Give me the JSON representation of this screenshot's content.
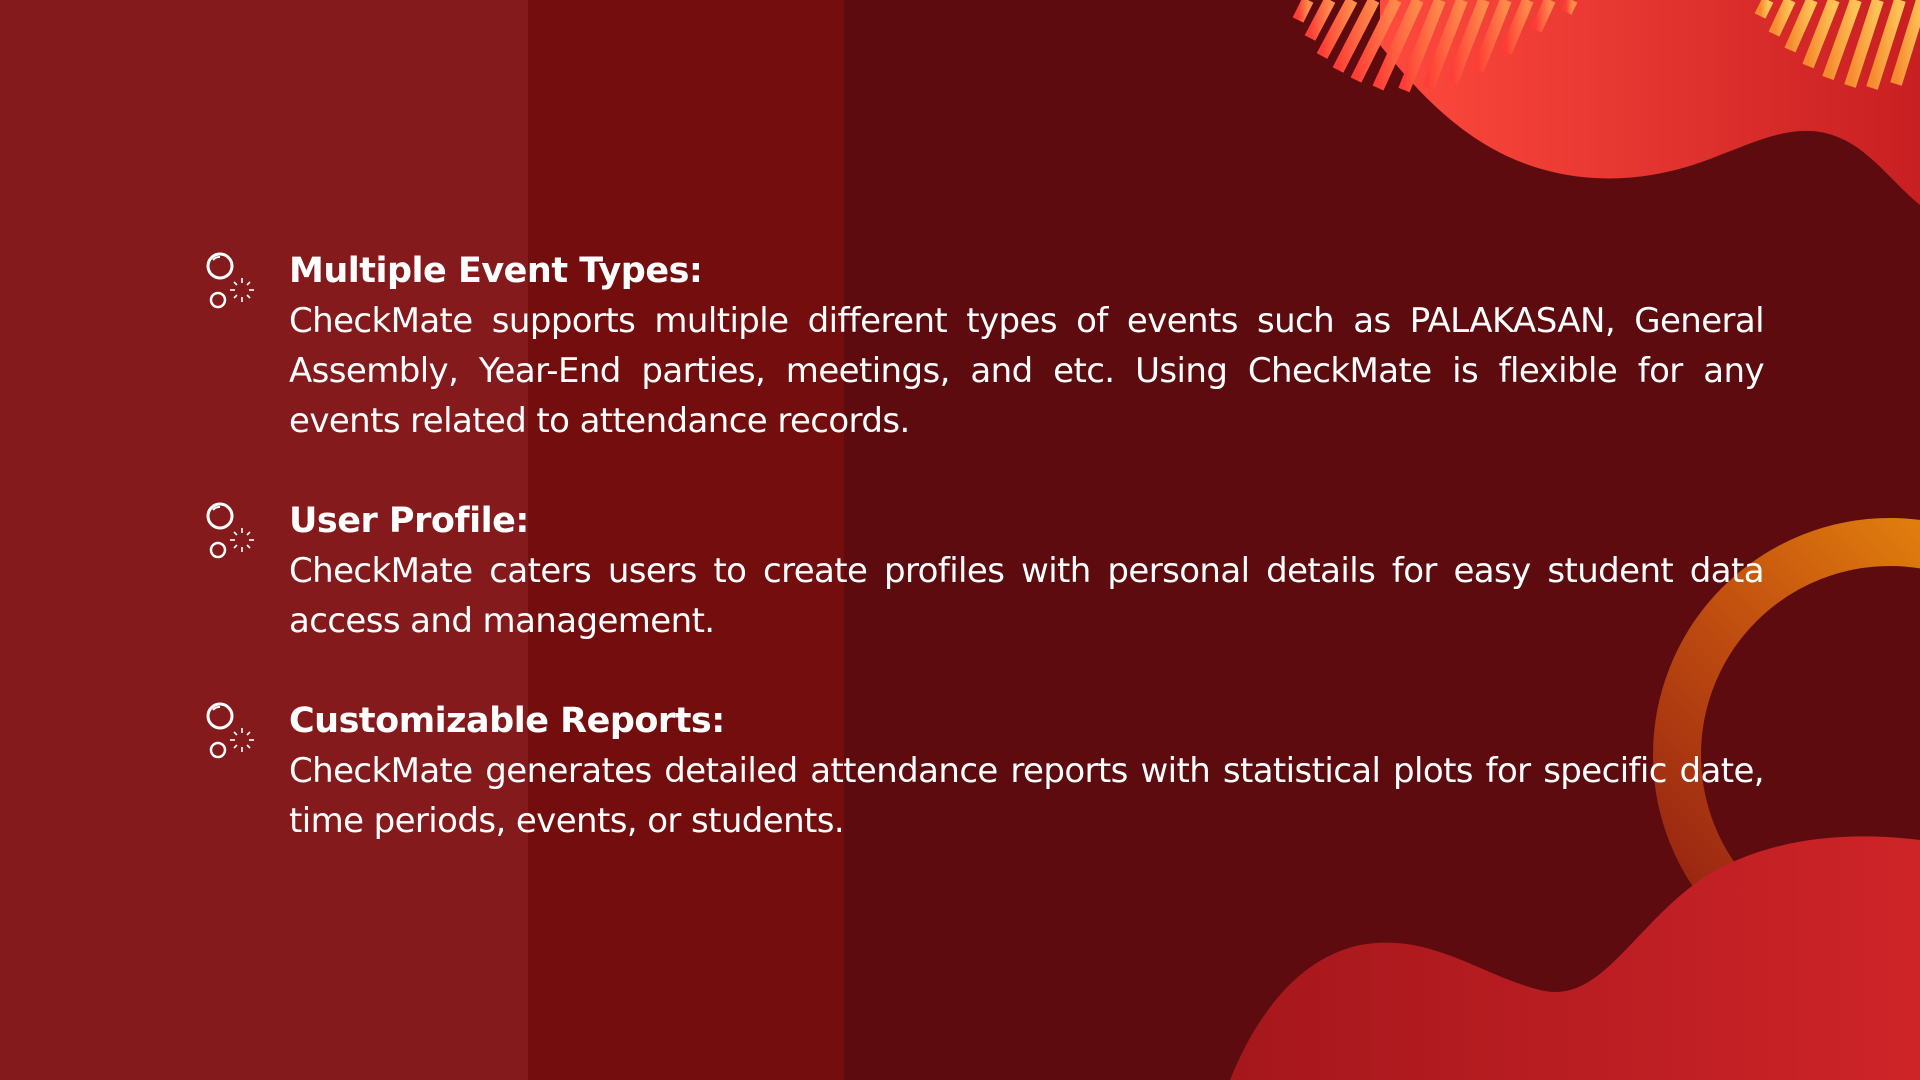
{
  "colors": {
    "background_dark": "#5d0b0f",
    "band_light": "#851a1d",
    "band_mid": "#730d0e",
    "accent_red": "#f0413b",
    "accent_orange": "#e8900f",
    "accent_yellow": "#f7b84b",
    "text": "#ffffff"
  },
  "features": [
    {
      "icon": "bubbles-icon",
      "title": "Multiple Event Types:",
      "description": "CheckMate supports multiple different types of events such as PALAKASAN, General Assembly, Year-End parties, meetings, and etc. Using CheckMate is flexible for any events related to attendance records."
    },
    {
      "icon": "bubbles-icon",
      "title": "User Profile:",
      "description": "CheckMate caters users to create profiles with personal details for easy student data access and management."
    },
    {
      "icon": "bubbles-icon",
      "title": "Customizable Reports:",
      "description": "CheckMate generates detailed attendance reports with statistical plots for specific date, time periods, events, or students."
    }
  ]
}
